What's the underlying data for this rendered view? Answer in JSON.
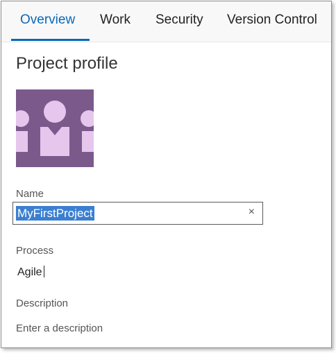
{
  "tabs": [
    {
      "label": "Overview",
      "active": true
    },
    {
      "label": "Work",
      "active": false
    },
    {
      "label": "Security",
      "active": false
    },
    {
      "label": "Version Control",
      "active": false
    }
  ],
  "page_title": "Project profile",
  "avatar": {
    "icon": "team-people-icon",
    "background_color": "#7b5a8b",
    "figure_color": "#e7c6ee"
  },
  "name": {
    "label": "Name",
    "value": "MyFirstProject",
    "clear_icon": "close-icon",
    "clear_glyph": "×"
  },
  "process": {
    "label": "Process",
    "value": "Agile"
  },
  "description": {
    "label": "Description",
    "placeholder": "Enter a description"
  },
  "colors": {
    "accent": "#0a68b8",
    "selection": "#3b7fd1"
  }
}
